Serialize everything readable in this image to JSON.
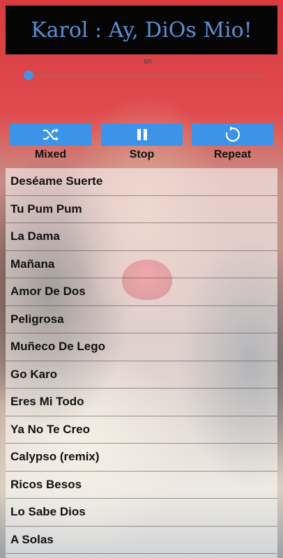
{
  "header": {
    "title": "Karol : Ay, DiOs Mio!"
  },
  "player": {
    "time_label": "sn",
    "progress": 0.0
  },
  "controls": {
    "mixed_label": "Mixed",
    "stop_label": "Stop",
    "repeat_label": "Repeat",
    "accent": "#3d93e8"
  },
  "songs": [
    "Deséame Suerte",
    "Tu Pum Pum",
    "La Dama",
    "Mañana",
    "Amor De Dos",
    "Peligrosa",
    "Muñeco De Lego",
    "Go Karo",
    "Eres Mi Todo",
    "Ya No Te Creo",
    "Calypso (remix)",
    "Ricos Besos",
    "Lo Sabe Dios",
    "A Solas"
  ],
  "icons": {
    "mixed": "shuffle-icon",
    "stop": "pause-icon",
    "repeat": "repeat-icon"
  }
}
